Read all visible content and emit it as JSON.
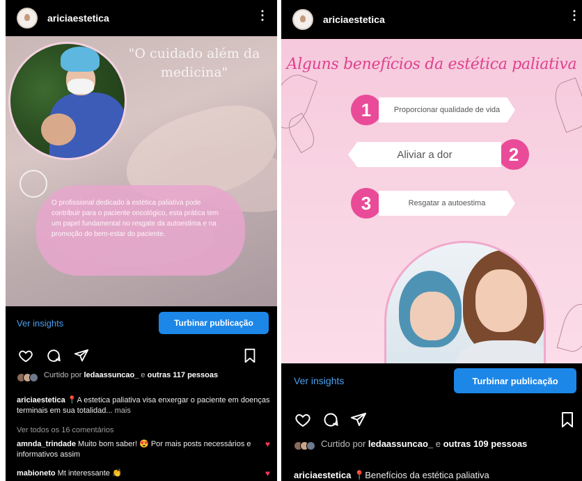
{
  "left_post": {
    "username": "ariciaestetica",
    "quote": "\"O cuidado além da medicina\"",
    "bubble_text": "O profissional dedicado à estética paliativa pode contribuir para o paciente oncológico, esta prática tem um papel fundamental no resgate da autoestima e na promoção do bem-estar do paciente.",
    "insights_label": "Ver insights",
    "boost_label": "Turbinar publicação",
    "likes_prefix": "Curtido por ",
    "likes_user": "ledaassuncao_",
    "likes_suffix": " e ",
    "likes_others": "outras 117 pessoas",
    "caption_user": "ariciaestetica",
    "caption_text": " 📍A estetica paliativa visa enxergar o paciente em doenças terminais em sua totalidad...",
    "caption_more": " mais",
    "view_comments": "Ver todos os 16 comentários",
    "comments": [
      {
        "user": "amnda_trindade",
        "text": " Muito bom saber! 😍 Por mais posts necessários e informativos assim"
      },
      {
        "user": "mabioneto",
        "text": " Mt interessante 👏"
      }
    ]
  },
  "right_post": {
    "username": "ariciaestetica",
    "title": "Alguns benefícios da estética paliativa",
    "benefits": [
      {
        "number": "1",
        "text": "Proporcionar qualidade de vida"
      },
      {
        "number": "2",
        "text": "Aliviar a dor"
      },
      {
        "number": "3",
        "text": "Resgatar a autoestima"
      }
    ],
    "insights_label": "Ver insights",
    "boost_label": "Turbinar publicação",
    "likes_prefix": "Curtido por ",
    "likes_user": "ledaassuncao_",
    "likes_suffix": " e ",
    "likes_others": "outras 109 pessoas",
    "caption_user": "ariciaestetica",
    "caption_text": " 📍Benefícios da estética paliativa"
  },
  "icons": [
    "heart-icon",
    "comment-icon",
    "share-icon",
    "bookmark-icon",
    "more-icon"
  ],
  "colors": {
    "accent_blue": "#1d87e8",
    "link_blue": "#4aa0f0",
    "pink": "#e94b98",
    "like_red": "#ed3a52"
  }
}
